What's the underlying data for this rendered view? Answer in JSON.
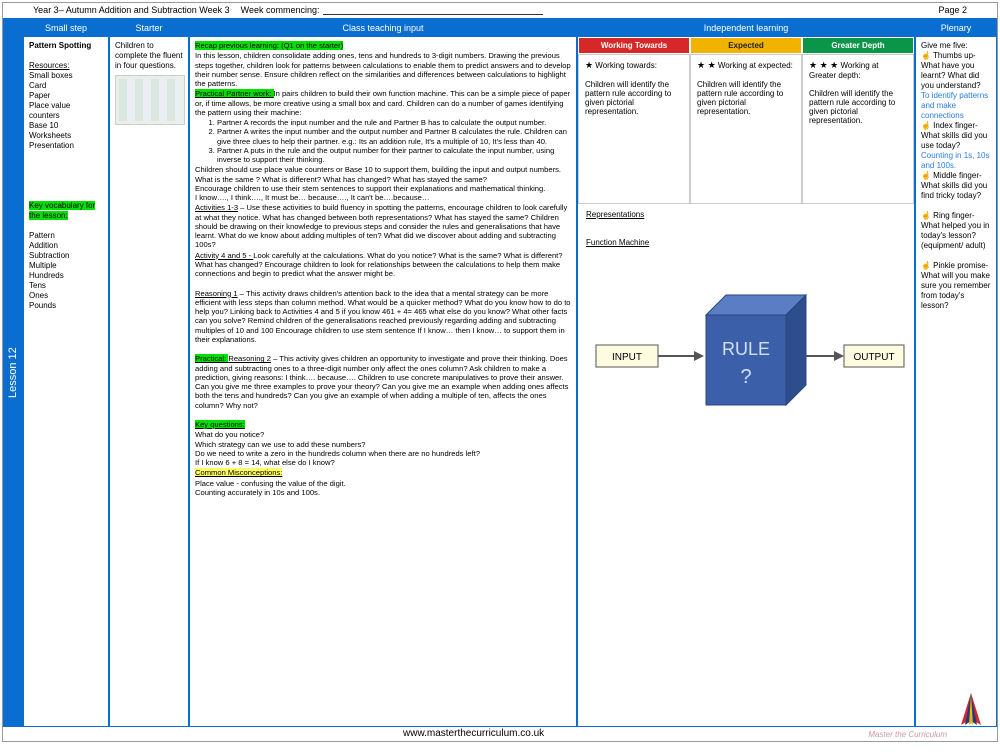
{
  "header": {
    "course": "Year 3– Autumn Addition and Subtraction Week 3",
    "week_label": "Week commencing:",
    "page": "Page 2"
  },
  "lesson_tab": "Lesson 12",
  "columns": {
    "smallstep": "Small step",
    "starter": "Starter",
    "teaching": "Class teaching input",
    "independent": "Independent learning",
    "plenary": "Plenary"
  },
  "smallstep": {
    "title": "Pattern Spotting",
    "resources_label": "Resources:",
    "resources": "Small boxes\nCard\nPaper\nPlace value counters\nBase 10\nWorksheets\nPresentation",
    "keyvocab_label": "Key vocabulary for the lesson:",
    "keyvocab": "Pattern\nAddition\nSubtraction\nMultiple\nHundreds\nTens\nOnes\nPounds"
  },
  "starter": {
    "text": "Children to complete the fluent in four questions."
  },
  "teaching": {
    "recap_label": "Recap previous learning: (Q1 on the starter)",
    "recap_body": "In this lesson, children consolidate adding ones, tens and hundreds to 3-digit numbers. Drawing the previous steps together, children look for patterns between calculations to enable them to predict answers and to develop their number sense. Ensure children reflect on the similarities and differences between calculations to highlight the patterns.",
    "practical_label": "Practical Partner work:  ",
    "practical_body": "In pairs children to build their own function machine. This can be a simple piece of paper or, if time allows, be more creative using a small box and card.  Children can do a number of games identifying the pattern using their machine:",
    "steps": [
      "Partner A records the input number and the rule and Partner B has to calculate the output number.",
      "Partner A writes the  input number and  the output number and Partner B calculates the rule.  Children can give three clues to help their partner. e.g.:  Its an addition rule,  It's a multiple of 10, It's less than 40.",
      "Partner A puts in the rule and the output number for their partner to calculate the input number, using inverse to support their thinking."
    ],
    "after_steps": "Children should use place value counters or Base 10 to support them, building the input and output numbers. What is the same ? What is different?  What has changed?  What has stayed the same?\nEncourage children to use their stem sentences to support their explanations and mathematical thinking.\nI know…., I think…., It must be… because…., It can't be….because…",
    "activities13_label": "Activities 1-3",
    "activities13_body": " – Use these activities to build fluency in spotting the patterns, encourage children to look carefully at what they notice.  What has changed between both representations?  What has stayed the same? Children should be drawing on their knowledge to previous steps  and consider the rules and generalisations that have learnt.  What do we know about adding multiples of ten? What did we discover about adding and subtracting 100s?",
    "activity45_label": "Activity 4 and 5 - ",
    "activity45_body": "  Look carefully at the calculations.  What do you notice? What is the same? What is different?  What has changed? Encourage children to look for relationships between the calculations to help them make connections and begin to predict what the answer might be.",
    "reasoning1_label": "Reasoning 1",
    "reasoning1_body": " – This activity draws children's attention back to the idea that a mental strategy can be more efficient with less steps than column method.  What would be a quicker method?  What do you know how to do to help you?   Linking back to Activities 4 and 5 if you know 461  + 4= 465 what else do you know?  What other facts can you solve? Remind children of the generalisations reached previously regarding adding and subtracting multiples of 10 and 100  Encourage children to use stem sentence  If I know… then I know… to support them in their explanations.",
    "practical2_label": "Practical:   ",
    "reasoning2_label": "Reasoning 2",
    "reasoning2_body": " – This activity gives children an opportunity to  investigate and prove their thinking.  Does adding and subtracting ones to a three-digit number only affect the ones column?  Ask children to make a prediction, giving reasons:  I think…. because….  Children to use concrete manipulatives to prove their answer.  Can you give me three examples to prove your theory?  Can you give me an example  when adding ones affects both the tens and hundreds?  Can you give an example of when adding a multiple of ten, affects the ones column?  Why not?",
    "keyq_label": "Key questions:",
    "keyq_body": "What do you notice?\nWhich strategy can we use to add these numbers?\nDo we need to write a zero in the hundreds column when there are no hundreds left?\nIf I know 6 + 8 = 14, what else do I know?",
    "misc_label": "Common Misconceptions:",
    "misc_body": "Place value  - confusing the value of the digit.\nCounting accurately  in 10s and 100s."
  },
  "independent": {
    "wt_h": "Working Towards",
    "ex_h": "Expected",
    "gd_h": "Greater Depth",
    "wt_stars": "★",
    "ex_stars": "★ ★",
    "gd_stars": "★ ★ ★",
    "wt_title": "  Working towards:",
    "ex_title": "  Working at expected:",
    "gd_title": "  Working at Greater depth:",
    "wt_body": "Children will identify the pattern rule according to given pictorial representation.",
    "ex_body": "Children will identify the pattern rule according to given pictorial representation.",
    "gd_body": "Children will identify the pattern rule according to given pictorial representation.",
    "rep_label": "Representations",
    "fm_label": "Function Machine",
    "fm_input": "INPUT",
    "fm_rule": "RULE",
    "fm_q": "?",
    "fm_output": "OUTPUT"
  },
  "plenary": {
    "intro": "Give me five:",
    "thumbs": "☝ Thumbs up- What have you learnt? What did you understand?",
    "thumbs_ans": "To identify patterns and make connections",
    "index": "☝ Index finger-  What skills did you use today?",
    "index_ans": "Counting in 1s, 10s and 100s.",
    "middle": "☝ Middle finger- What skills did you find tricky today?",
    "ring": "☝ Ring finger- What helped you in today's lesson? (equipment/ adult)",
    "pinkie": "☝ Pinkie promise- What will you make sure you remember from today's lesson?"
  },
  "footer": {
    "url": "www.masterthecurriculum.co.uk",
    "brand": "Master the Curriculum"
  }
}
